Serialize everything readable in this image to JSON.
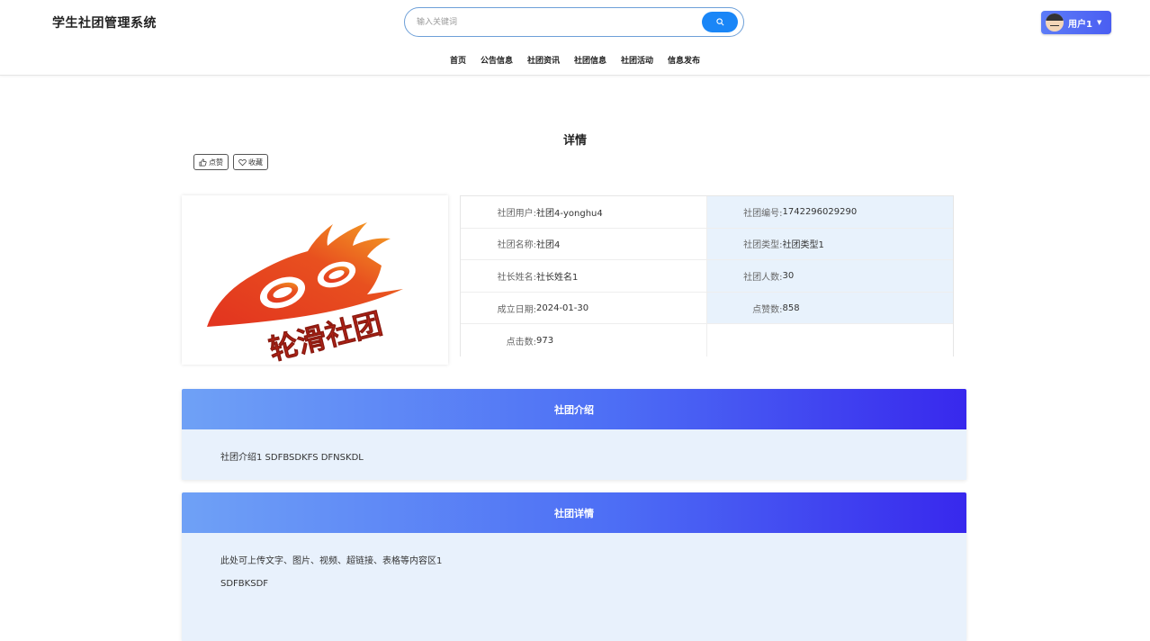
{
  "header": {
    "brand": "学生社团管理系统",
    "search_placeholder": "输入关键词",
    "user_label": "用户1"
  },
  "nav": {
    "items": [
      "首页",
      "公告信息",
      "社团资讯",
      "社团信息",
      "社团活动",
      "信息发布"
    ]
  },
  "page": {
    "title": "详情",
    "like_label": "点赞",
    "favorite_label": "收藏"
  },
  "image": {
    "logo_text": "轮滑社团",
    "colors": {
      "flame": "#e2331f",
      "gradient_end": "#f5a623",
      "text": "#c8261a"
    }
  },
  "info": {
    "rows": [
      {
        "l_label": "社团用户:",
        "l_value": "社团4-yonghu4",
        "r_label": "社团编号:",
        "r_value": "1742296029290"
      },
      {
        "l_label": "社团名称:",
        "l_value": "社团4",
        "r_label": "社团类型:",
        "r_value": "社团类型1"
      },
      {
        "l_label": "社长姓名:",
        "l_value": "社长姓名1",
        "r_label": "社团人数:",
        "r_value": "30"
      },
      {
        "l_label": "成立日期:",
        "l_value": "2024-01-30",
        "r_label": "点赞数:",
        "r_value": "858"
      },
      {
        "l_label": "点击数:",
        "l_value": "973",
        "r_label": "",
        "r_value": ""
      }
    ]
  },
  "intro": {
    "title": "社团介绍",
    "content": "社团介绍1 SDFBSDKFS DFNSKDL"
  },
  "detail": {
    "title": "社团详情",
    "line1": "此处可上传文字、图片、视频、超链接、表格等内容区1",
    "line2": "SDFBKSDF"
  },
  "colors": {
    "accent": "#1a86f7",
    "header_gradient_start": "#6fa1f6",
    "header_gradient_end": "#3828ed",
    "panel_bg": "#e8f1fc"
  }
}
